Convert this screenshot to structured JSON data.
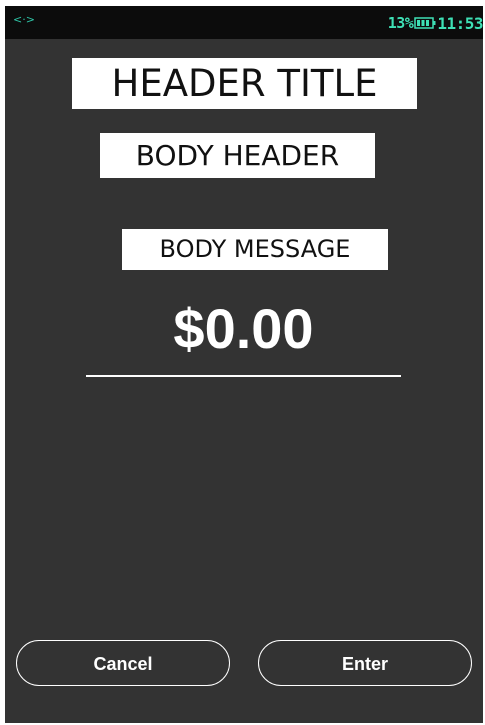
{
  "status_bar": {
    "left_icon": "<·>",
    "battery_percent": "13%",
    "time": "11:53",
    "accent_color": "#3ee0b5"
  },
  "header_title": "HEADER TITLE",
  "body_header": "BODY HEADER",
  "body_message": "BODY MESSAGE",
  "amount": "$0.00",
  "buttons": {
    "cancel": "Cancel",
    "enter": "Enter"
  },
  "colors": {
    "screen_background": "#333333",
    "status_bar_background": "#0c0c0c",
    "label_background": "#ffffff"
  }
}
